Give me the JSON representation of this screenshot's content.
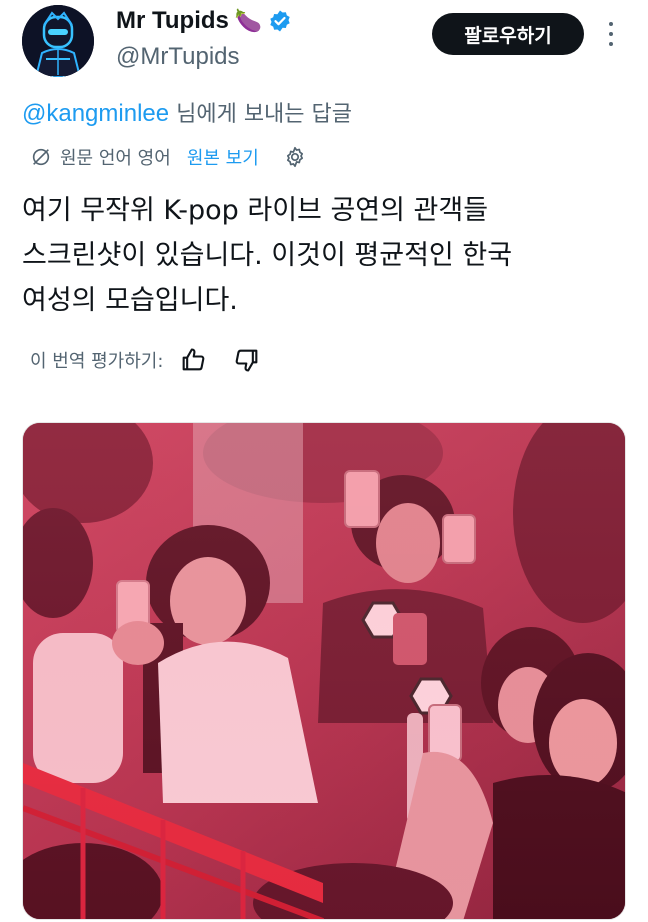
{
  "tweet": {
    "author": {
      "display_name": "Mr Tupids",
      "name_emoji": "🍆",
      "handle": "@MrTupids",
      "avatar_icon": "avatar-neon-robot",
      "verified_icon": "verified-badge-icon",
      "verified_color": "#1d9bf0"
    },
    "follow_label": "팔로우하기",
    "more_icon": "more-vertical-icon",
    "reply_to": {
      "mention": "@kangminlee",
      "suffix": " 님에게 보내는 답글"
    },
    "translation": {
      "note": "원문 언어 영어",
      "view_original": "원본 보기",
      "icon": "translate-off-icon",
      "settings_icon": "gear-icon"
    },
    "text_lines": [
      "여기 무작위 K-pop 라이브 공연의 관객들",
      "스크린샷이 있습니다. 이것이 평균적인 한국",
      "여성의 모습입니다."
    ],
    "rating": {
      "prompt": "이 번역 평가하기:",
      "like_icon": "thumbs-up-icon",
      "dislike_icon": "thumbs-down-icon"
    },
    "media": {
      "kind": "photo",
      "subject": "concert-audience-photo"
    }
  },
  "colors": {
    "accent": "#1d9bf0",
    "text_primary": "#0f1419",
    "text_secondary": "#536471",
    "button_bg": "#0f1419"
  }
}
